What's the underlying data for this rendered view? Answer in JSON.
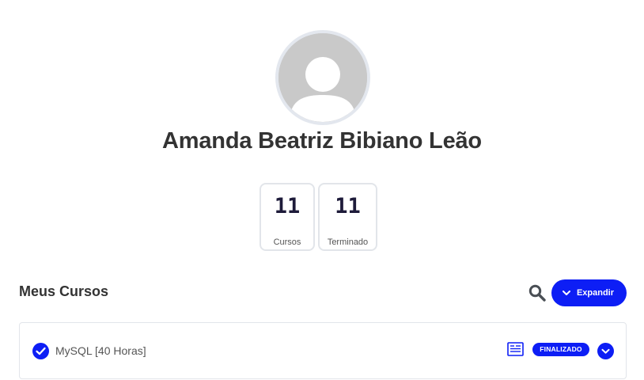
{
  "profile": {
    "name": "Amanda Beatriz Bibiano Leão",
    "avatar_icon": "user-placeholder-icon"
  },
  "stats": [
    {
      "value": "11",
      "label": "Cursos"
    },
    {
      "value": "11",
      "label": "Terminado"
    }
  ],
  "section": {
    "title": "Meus Cursos",
    "search_icon": "search-icon",
    "expand_label": "Expandir"
  },
  "courses": [
    {
      "title": "MySQL [40 Horas]",
      "status": "FINALIZADO",
      "completed": true
    }
  ],
  "colors": {
    "accent": "#0d1ef5",
    "text": "#333333",
    "border": "#e2e5ea"
  }
}
